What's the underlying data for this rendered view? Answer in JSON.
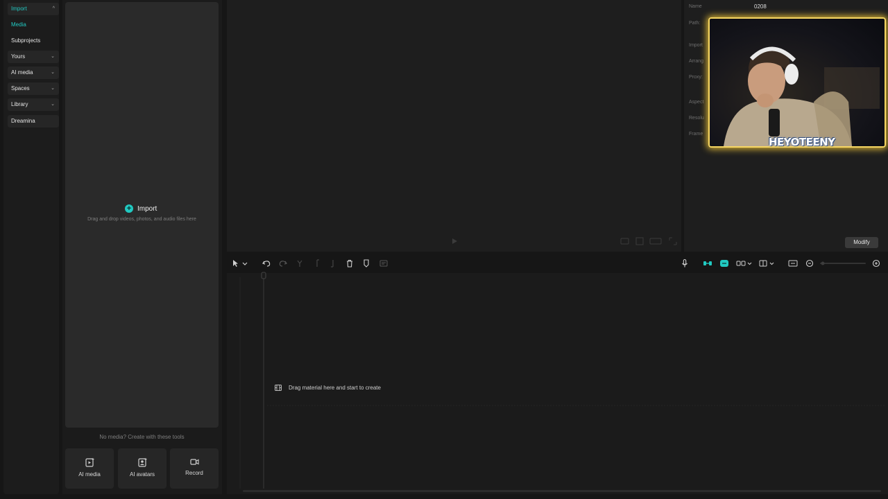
{
  "nav": {
    "items": [
      {
        "label": "Import",
        "chevron": "^",
        "state": "active-box"
      },
      {
        "label": "Media",
        "chevron": "",
        "state": "active"
      },
      {
        "label": "Subprojects",
        "chevron": "",
        "state": "plain"
      },
      {
        "label": "Yours",
        "chevron": "v",
        "state": "box"
      },
      {
        "label": "AI media",
        "chevron": "v",
        "state": "box"
      },
      {
        "label": "Spaces",
        "chevron": "v",
        "state": "box"
      },
      {
        "label": "Library",
        "chevron": "v",
        "state": "box"
      },
      {
        "label": "Dreamina",
        "chevron": "",
        "state": "box"
      }
    ]
  },
  "media": {
    "import_label": "Import",
    "drop_hint": "Drag and drop videos, photos, and audio files here",
    "no_media_text": "No media? Create with these tools",
    "tools": [
      {
        "label": "AI media",
        "icon": "ai-media-icon"
      },
      {
        "label": "AI avatars",
        "icon": "ai-avatar-icon"
      },
      {
        "label": "Record",
        "icon": "record-icon"
      }
    ]
  },
  "details": {
    "name_label": "Name",
    "name_value": "0208",
    "labels": [
      "Path:",
      "Import",
      "Arrang",
      "Proxy:",
      "Aspect",
      "Resolu",
      "Frame"
    ],
    "modify_label": "Modify"
  },
  "webcam": {
    "overlay_text": "HEYOTEENY"
  },
  "timeline": {
    "drop_hint": "Drag material here and start to create",
    "playhead_value": "0"
  },
  "colors": {
    "accent": "#21c9c1",
    "webcam_border": "#f7d763"
  },
  "toolbar_icons": [
    "select-arrow-icon",
    "undo-icon",
    "redo-icon",
    "split-icon",
    "trim-left-icon",
    "trim-right-icon",
    "delete-icon",
    "marker-icon",
    "freeze-icon",
    "microphone-icon",
    "link-icon",
    "magnet-icon",
    "snap-icon",
    "preview-axis-icon",
    "caption-icon",
    "zoom-out-icon",
    "zoom-in-icon"
  ]
}
